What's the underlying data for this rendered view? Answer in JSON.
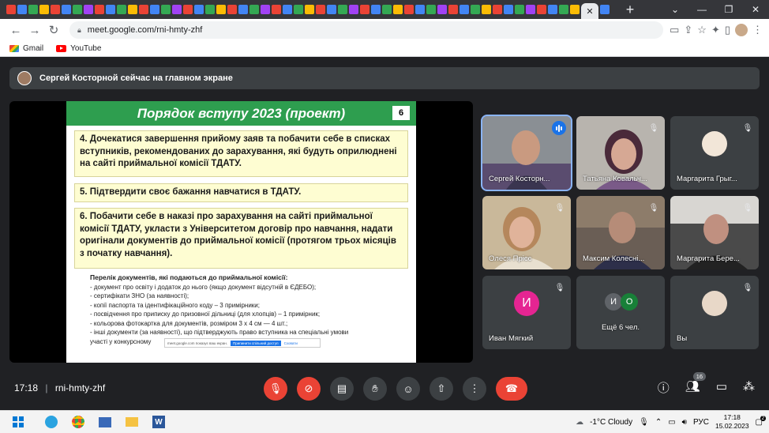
{
  "browser": {
    "tab_icon_colors": [
      "#ea4335",
      "#4285f4",
      "#34a853",
      "#fbbc05",
      "#ea4335",
      "#4285f4",
      "#34a853",
      "#a142f4",
      "#ea4335",
      "#4285f4",
      "#34a853",
      "#fbbc05",
      "#ea4335",
      "#4285f4",
      "#34a853",
      "#a142f4",
      "#ea4335",
      "#4285f4",
      "#34a853",
      "#fbbc05",
      "#ea4335",
      "#4285f4",
      "#34a853",
      "#a142f4",
      "#ea4335",
      "#4285f4",
      "#34a853",
      "#fbbc05",
      "#ea4335",
      "#4285f4",
      "#34a853",
      "#a142f4",
      "#ea4335",
      "#4285f4",
      "#34a853",
      "#fbbc05",
      "#ea4335",
      "#4285f4",
      "#34a853",
      "#a142f4",
      "#ea4335",
      "#4285f4",
      "#34a853",
      "#fbbc05",
      "#ea4335",
      "#4285f4",
      "#34a853",
      "#a142f4",
      "#ea4335",
      "#4285f4",
      "#34a853",
      "#fbbc05",
      "#ea4335",
      "#4285f4"
    ],
    "url": "meet.google.com/rni-hmty-zhf",
    "bookmarks": [
      {
        "label": "Gmail",
        "icon": "gmail-icon"
      },
      {
        "label": "YouTube",
        "icon": "youtube-icon"
      }
    ]
  },
  "meet": {
    "banner_text": "Сергей Косторной сейчас на главном экране",
    "slide": {
      "title": "Порядок вступу 2023 (проект)",
      "number": "6",
      "item4": "4. Дочекатися завершення прийому заяв та побачити себе в списках вступників, рекомендованих до зарахування, які будуть оприлюднені на сайті приймальної комісії ТДАТУ.",
      "item5": "5. Підтвердити своє бажання навчатися в ТДАТУ.",
      "item6": "6. Побачити себе в наказі про зарахування на сайті приймальної комісії ТДАТУ, укласти з Університетом договір про навчання, надати оригінали документів до приймальної комісії (протягом трьох місяців з початку навчання).",
      "docs_header": "Перелік документів, які подаються до приймальної комісії:",
      "docs": [
        "- документ про освіту і додаток до нього (якщо документ відсутній в ЄДЕБО);",
        "- сертифікати ЗНО (за наявності);",
        "- копії паспорта та ідентифікаційного коду – 3 примірники;",
        "- посвідчення про приписку до призовної дільниці (для хлопців) – 1 примірник;",
        "- кольорова фотокартка для документів, розміром 3 х 4 см — 4 шт.;",
        "- інші документи (за наявності), що підтверджують право вступника на спеціальні умови",
        "   участі у конкурсному"
      ],
      "popup_text": "meet.google.com показує ваш екран.",
      "popup_button": "Припинити спільний доступ",
      "popup_link": "Сховати"
    },
    "participants": [
      {
        "name": "Сергей Косторн...",
        "speaking": true
      },
      {
        "name": "Татьяна Ковальч...",
        "speaking": false
      },
      {
        "name": "Маргарита Грыг...",
        "speaking": false
      },
      {
        "name": "Олеся Прісс",
        "speaking": false
      },
      {
        "name": "Максим Колесні...",
        "speaking": false
      },
      {
        "name": "Маргарита Бере...",
        "speaking": false
      },
      {
        "name": "Иван Мягкий",
        "initial": "И",
        "color": "#e52592"
      },
      {
        "name": "Ещё 6 чел.",
        "initials": [
          "И",
          "О"
        ],
        "colors": [
          "#5f6368",
          "#188038"
        ]
      },
      {
        "name": "Вы",
        "speaking": false
      }
    ],
    "bottom": {
      "time": "17:18",
      "separator": "|",
      "meeting_code": "rni-hmty-zhf",
      "people_count": "16"
    }
  },
  "taskbar": {
    "weather": "-1°C  Cloudy",
    "lang": "РУС",
    "time": "17:18",
    "date": "15.02.2023",
    "notifications": "2"
  }
}
